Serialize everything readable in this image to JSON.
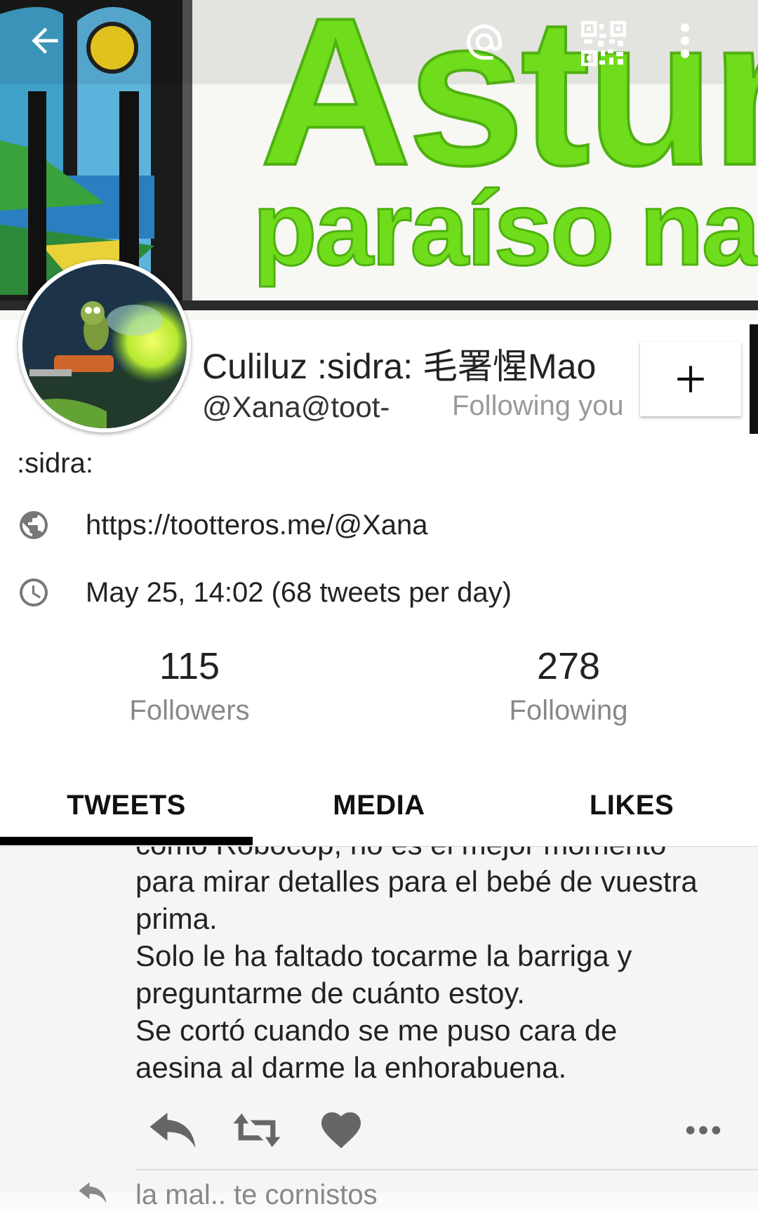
{
  "header": {
    "banner_title": "Asturi",
    "banner_subtitle": "paraíso na",
    "icons": [
      "back-arrow-icon",
      "at-icon",
      "qr-code-icon",
      "more-vertical-icon"
    ]
  },
  "profile": {
    "display_name": ":sidra: ",
    "display_name_full": "Culiluz :sidra: 毛署惺Mao",
    "handle": "@Xana@toot-",
    "follows_you": "Following you",
    "bio": ":sidra:",
    "link": "https://tootteros.me/@Xana",
    "joined": "May 25, 14:02 (68 tweets per day)"
  },
  "stats": {
    "followers_count": "115",
    "followers_label": "Followers",
    "following_count": "278",
    "following_label": "Following"
  },
  "tabs": [
    {
      "label": "TWEETS",
      "selected": true
    },
    {
      "label": "MEDIA",
      "selected": false
    },
    {
      "label": "LIKES",
      "selected": false
    }
  ],
  "tweet": {
    "text": "como Robocop, no es el mejor momento\npara mirar detalles para el bebé de vuestra\nprima.\nSolo le ha faltado tocarme la barriga y\npreguntarme de cuánto estoy.\nSe cortó cuando se me puso cara de\naesina al darme la enhorabuena.",
    "next_preview": "la mal.. te cornistos"
  },
  "colors": {
    "banner_green": "#6fdc1c",
    "panel": "#ffffff",
    "feed_bg": "#f5f5f5",
    "tab_indicator": "#000000",
    "muted_text": "#888888"
  }
}
